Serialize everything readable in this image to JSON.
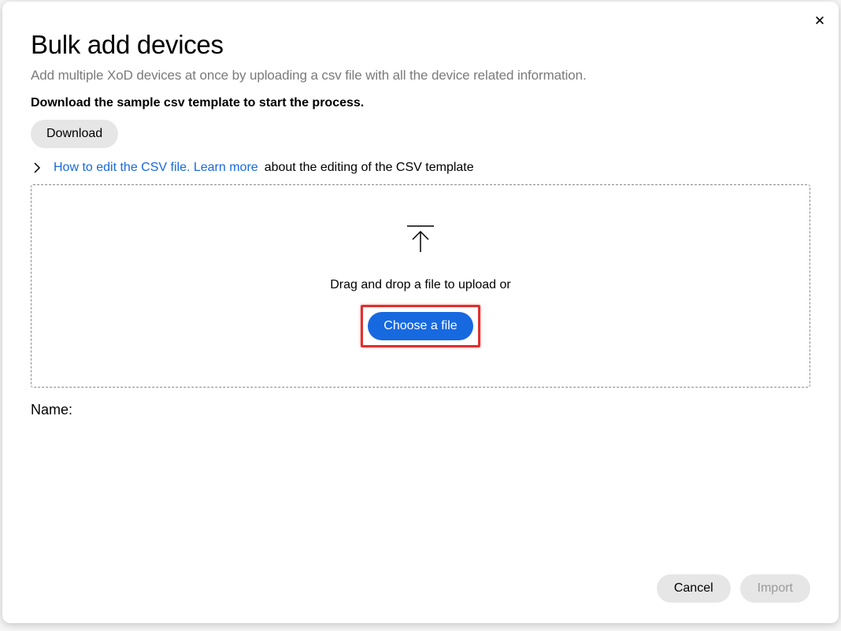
{
  "modal": {
    "title": "Bulk add devices",
    "description": "Add multiple XoD devices at once by uploading a csv file with all the device related information.",
    "download_instruction": "Download the sample csv template to start the process.",
    "download_label": "Download",
    "learn_more_link": "How to edit the CSV file. Learn more",
    "learn_more_suffix": " about the editing of the CSV template",
    "dropzone_text": "Drag and drop a file to upload or",
    "choose_file_label": "Choose a file",
    "name_label": "Name:"
  },
  "footer": {
    "cancel_label": "Cancel",
    "import_label": "Import"
  }
}
